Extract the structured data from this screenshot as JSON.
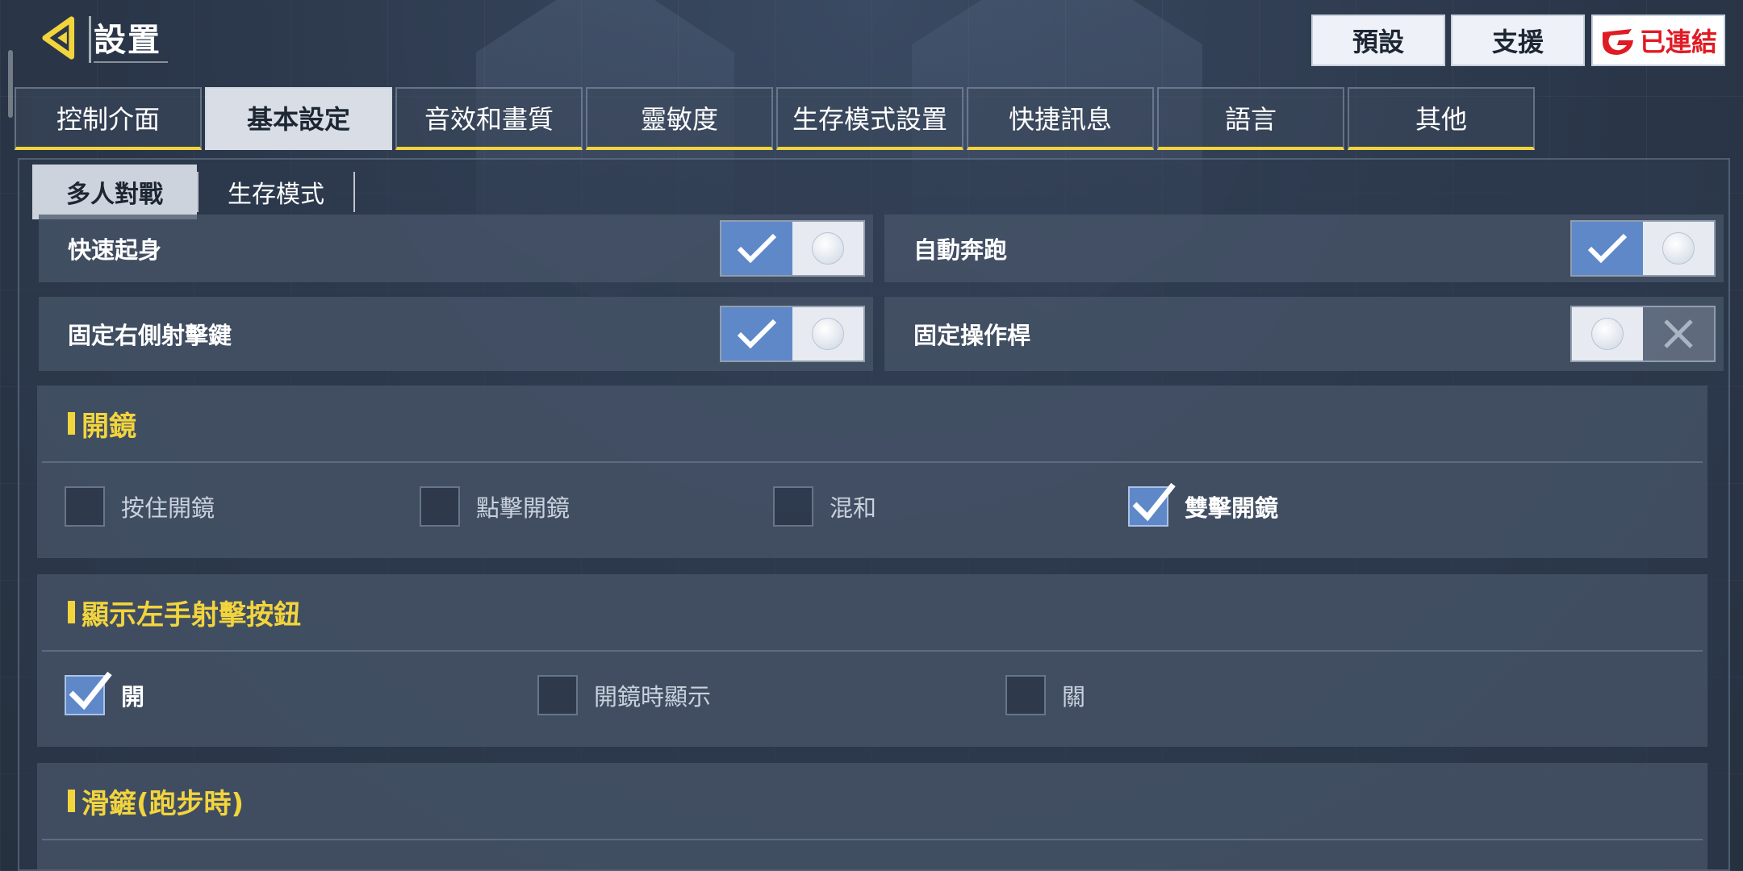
{
  "header": {
    "title": "設置",
    "buttons": {
      "default": "預設",
      "support": "支援",
      "connected": "已連結"
    }
  },
  "tabs": [
    {
      "label": "控制介面",
      "active": false
    },
    {
      "label": "基本設定",
      "active": true
    },
    {
      "label": "音效和畫質",
      "active": false
    },
    {
      "label": "靈敏度",
      "active": false
    },
    {
      "label": "生存模式設置",
      "active": false
    },
    {
      "label": "快捷訊息",
      "active": false
    },
    {
      "label": "語言",
      "active": false
    },
    {
      "label": "其他",
      "active": false
    }
  ],
  "subtabs": [
    {
      "label": "多人對戰",
      "active": true
    },
    {
      "label": "生存模式",
      "active": false
    }
  ],
  "toggles": [
    {
      "label": "快速起身",
      "on": true
    },
    {
      "label": "自動奔跑",
      "on": true
    },
    {
      "label": "固定右側射擊鍵",
      "on": true
    },
    {
      "label": "固定操作桿",
      "on": false
    }
  ],
  "sections": {
    "scope": {
      "title": "開鏡",
      "options": [
        {
          "label": "按住開鏡",
          "checked": false
        },
        {
          "label": "點擊開鏡",
          "checked": false
        },
        {
          "label": "混和",
          "checked": false
        },
        {
          "label": "雙擊開鏡",
          "checked": true
        }
      ]
    },
    "left_fire": {
      "title": "顯示左手射擊按鈕",
      "options": [
        {
          "label": "開",
          "checked": true
        },
        {
          "label": "開鏡時顯示",
          "checked": false
        },
        {
          "label": "關",
          "checked": false
        }
      ]
    },
    "slide": {
      "title": "滑鏟(跑步時)"
    }
  },
  "colors": {
    "accent_yellow": "#f2d43d",
    "toggle_on_blue": "#5f88c9",
    "brand_red": "#e01b24"
  },
  "icons": {
    "back": "back-arrow-icon",
    "check": "check-icon",
    "cross": "cross-icon",
    "garena": "garena-logo-icon"
  }
}
